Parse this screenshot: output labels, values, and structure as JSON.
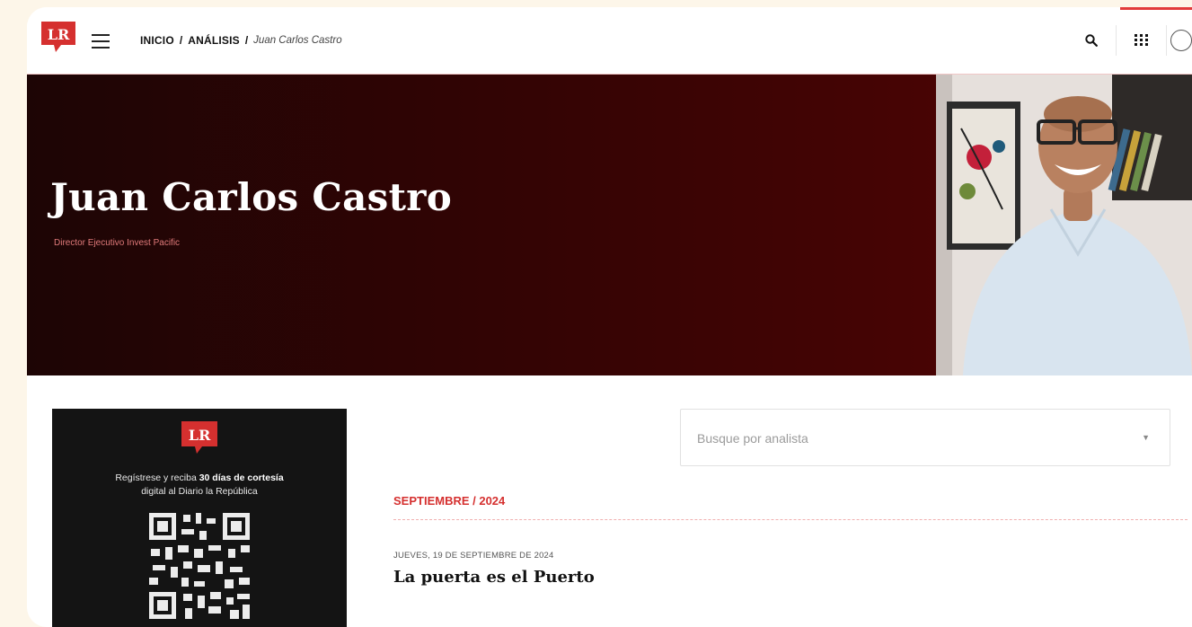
{
  "header": {
    "logo_text": "LR",
    "breadcrumb": {
      "home": "INICIO",
      "separator": "/",
      "section": "ANÁLISIS",
      "current": "Juan Carlos Castro"
    },
    "icons": [
      "search-icon",
      "apps-grid-icon",
      "user-avatar-icon"
    ]
  },
  "hero": {
    "name": "Juan Carlos Castro",
    "role": "Director Ejecutivo Invest Pacific"
  },
  "promo": {
    "logo_text": "LR",
    "text_prefix": "Regístrese y reciba ",
    "text_bold": "30 días de cortesía",
    "text_suffix": "digital al Diario la República"
  },
  "filter": {
    "placeholder": "Busque por analista"
  },
  "articles_section": {
    "month_heading": "SEPTIEMBRE / 2024",
    "articles": [
      {
        "date": "JUEVES, 19 DE SEPTIEMBRE DE 2024",
        "title": "La puerta es el Puerto"
      }
    ]
  },
  "colors": {
    "brand_red": "#d5302f",
    "hero_dark": "#1d0505",
    "hero_light": "#550404"
  }
}
